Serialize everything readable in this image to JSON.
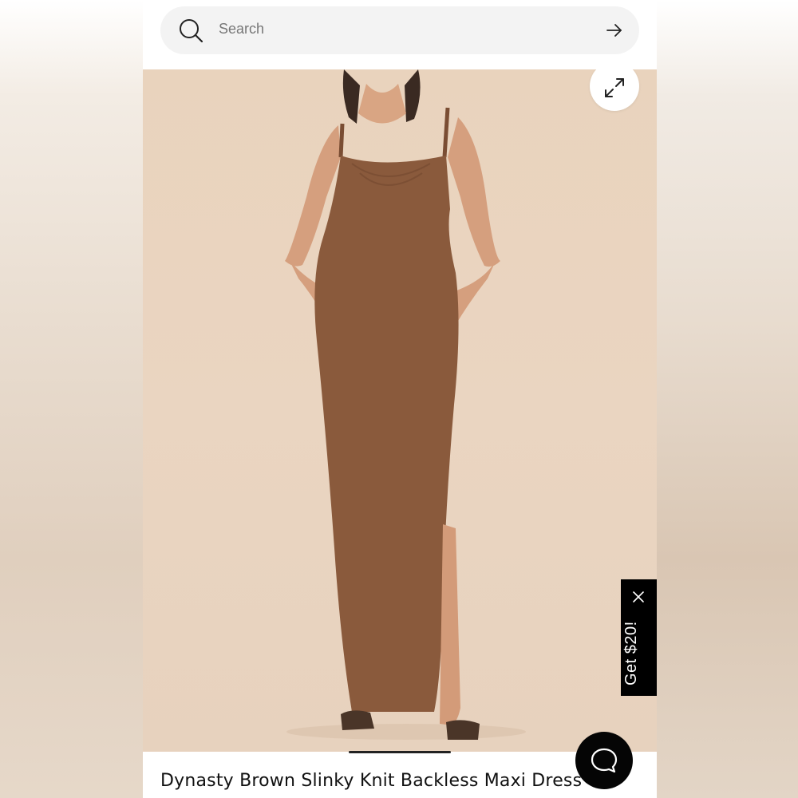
{
  "search": {
    "placeholder": "Search",
    "icon": "search-icon",
    "submit_icon": "arrow-right-icon"
  },
  "gallery": {
    "expand_icon": "expand-icon",
    "background_color": "#e9d3bd",
    "dress_color": "#8a5a3c"
  },
  "promo": {
    "label": "Get $20!",
    "close_icon": "close-icon",
    "background_color": "#000000"
  },
  "product": {
    "title": "Dynasty Brown Slinky Knit Backless Maxi Dress"
  },
  "chat": {
    "icon": "chat-bubble-icon"
  }
}
